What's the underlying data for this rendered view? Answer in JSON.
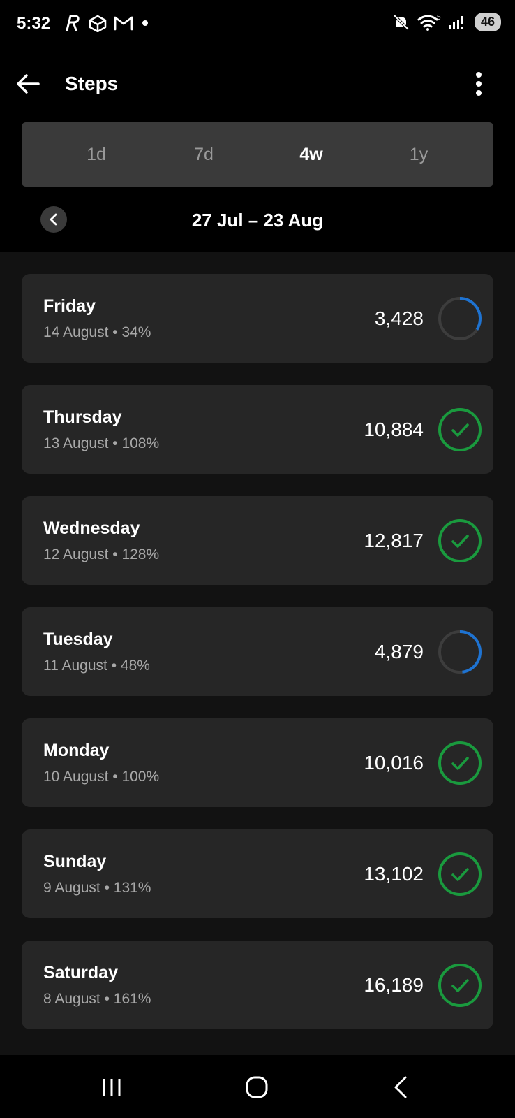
{
  "status_bar": {
    "time": "5:32",
    "battery": "46",
    "wifi_level": "5"
  },
  "header": {
    "title": "Steps"
  },
  "tabs": [
    {
      "label": "1d",
      "active": false
    },
    {
      "label": "7d",
      "active": false
    },
    {
      "label": "4w",
      "active": true
    },
    {
      "label": "1y",
      "active": false
    }
  ],
  "date_range": "27 Jul – 23 Aug",
  "days": [
    {
      "day": "Friday",
      "date": "14 August",
      "percent": "34%",
      "steps": "3,428",
      "progress": 0.34,
      "complete": false
    },
    {
      "day": "Thursday",
      "date": "13 August",
      "percent": "108%",
      "steps": "10,884",
      "progress": 1.08,
      "complete": true
    },
    {
      "day": "Wednesday",
      "date": "12 August",
      "percent": "128%",
      "steps": "12,817",
      "progress": 1.28,
      "complete": true
    },
    {
      "day": "Tuesday",
      "date": "11 August",
      "percent": "48%",
      "steps": "4,879",
      "progress": 0.48,
      "complete": false
    },
    {
      "day": "Monday",
      "date": "10 August",
      "percent": "100%",
      "steps": "10,016",
      "progress": 1.0,
      "complete": true
    },
    {
      "day": "Sunday",
      "date": "9 August",
      "percent": "131%",
      "steps": "13,102",
      "progress": 1.31,
      "complete": true
    },
    {
      "day": "Saturday",
      "date": "8 August",
      "percent": "161%",
      "steps": "16,189",
      "progress": 1.61,
      "complete": true
    }
  ],
  "colors": {
    "ring_progress": "#1e73d2",
    "ring_track": "#3d3d3d",
    "ring_complete": "#1a9a3e",
    "card_bg": "#262626"
  },
  "icons": {
    "back": "arrow-left-icon",
    "menu": "more-vertical-icon",
    "prev": "chevron-left-icon",
    "complete": "check-icon",
    "nav_recents": "recents-icon",
    "nav_home": "home-icon",
    "nav_back": "chevron-left-icon"
  }
}
